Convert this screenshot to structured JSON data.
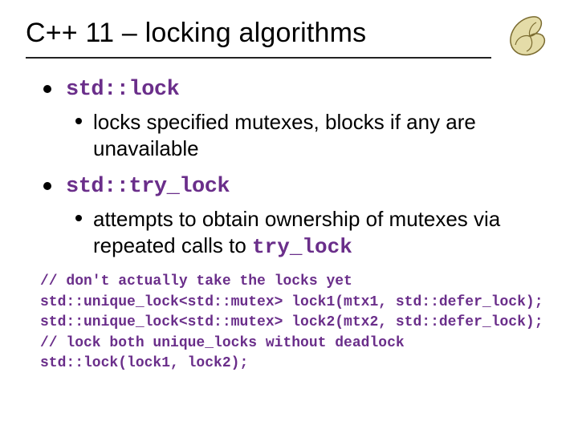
{
  "title": "C++ 11 – locking algorithms",
  "list": [
    {
      "head": "std::lock",
      "sub": [
        {
          "text": "locks specified mutexes, blocks if any are unavailable"
        }
      ]
    },
    {
      "head": "std::try_lock",
      "sub": [
        {
          "text_lead": "attempts to obtain ownership of mutexes via repeated calls to ",
          "code_tail": "try_lock"
        }
      ]
    }
  ],
  "code": [
    "// don't actually take the locks yet",
    "std::unique_lock<std::mutex> lock1(mtx1, std::defer_lock);",
    "std::unique_lock<std::mutex> lock2(mtx2, std::defer_lock);",
    "// lock both unique_locks without deadlock",
    "std::lock(lock1, lock2);"
  ]
}
